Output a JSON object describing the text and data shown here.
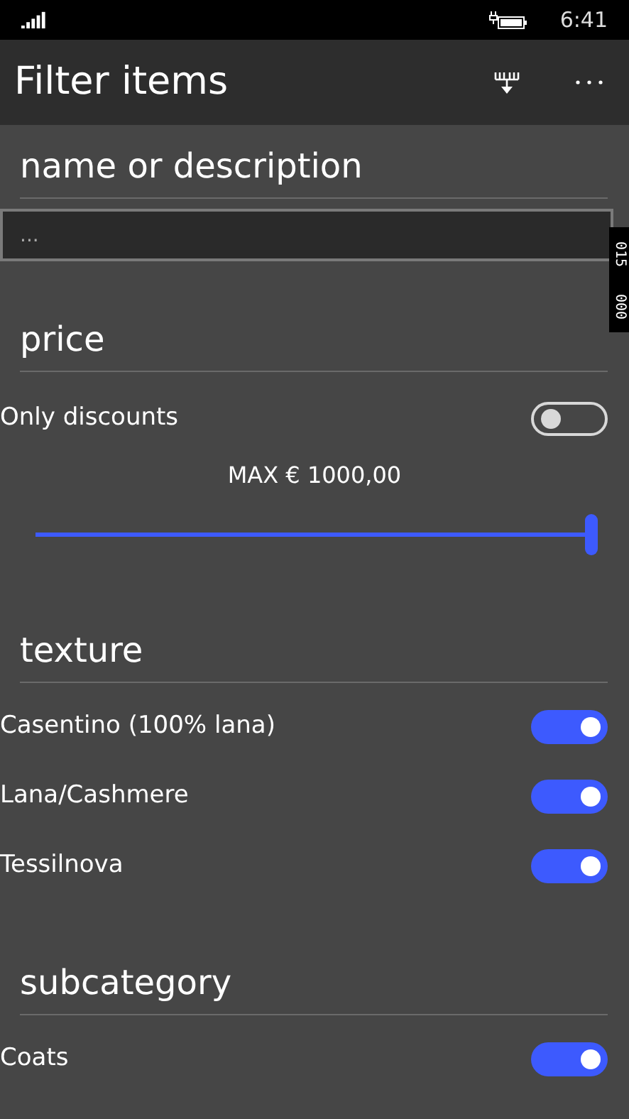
{
  "status_bar": {
    "time": "6:41"
  },
  "app_bar": {
    "title": "Filter items"
  },
  "frame_counters": [
    "015",
    "000"
  ],
  "name_section": {
    "heading": "name or description",
    "search": {
      "placeholder": "..."
    }
  },
  "price_section": {
    "heading": "price",
    "discounts": {
      "label": "Only discounts",
      "on": false
    },
    "slider": {
      "reading": "MAX € 1000,00",
      "level": 1
    }
  },
  "texture_section": {
    "heading": "texture",
    "items": [
      {
        "label": "Casentino (100% lana)",
        "on": true
      },
      {
        "label": "Lana/Cashmere",
        "on": true
      },
      {
        "label": "Tessilnova",
        "on": true
      }
    ]
  },
  "subcategory_section": {
    "heading": "subcategory",
    "items": [
      {
        "label": "Coats",
        "on": true
      }
    ]
  }
}
